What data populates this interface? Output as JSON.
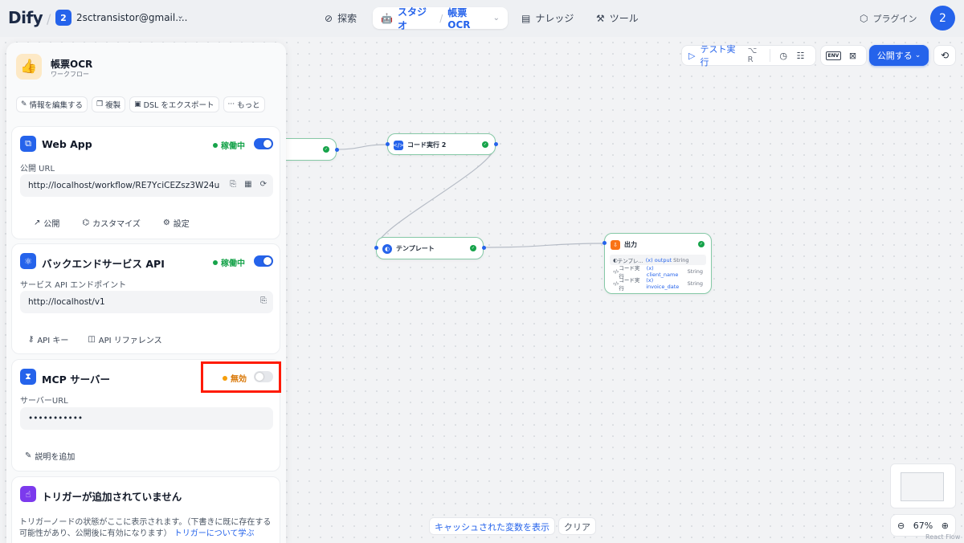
{
  "header": {
    "logo_text": "Dify",
    "workspace_badge": "2",
    "workspace_name": "2sctransistor@gmail....",
    "nav": {
      "explore": "探索",
      "studio": "スタジオ",
      "app_name": "帳票OCR",
      "knowledge": "ナレッジ",
      "tools": "ツール",
      "plugins": "プラグイン"
    },
    "avatar_text": "2"
  },
  "toolbar": {
    "test_run": "テスト実行",
    "test_run_shortcut": "⌥ R",
    "env_label": "ENV",
    "publish": "公開する"
  },
  "nodes": {
    "code2": {
      "title": "コード実行 2"
    },
    "template": {
      "title": "テンプレート"
    },
    "output": {
      "title": "出力",
      "rows": [
        {
          "source": "テンプレ...",
          "var": "output",
          "type": "String"
        },
        {
          "source": "コード実行",
          "var": "client_name",
          "type": "String"
        },
        {
          "source": "コード実行",
          "var": "invoice_date",
          "type": "String"
        }
      ]
    }
  },
  "canvas_footer": {
    "show_cached": "キャッシュされた変数を表示",
    "clear": "クリア",
    "zoom": "67%",
    "attribution": "React Flow"
  },
  "panel": {
    "app_name": "帳票OCR",
    "app_type": "ワークフロー",
    "actions": {
      "edit_info": "情報を編集する",
      "duplicate": "複製",
      "export_dsl": "DSL をエクスポート",
      "more": "もっと"
    },
    "webapp": {
      "title": "Web App",
      "status": "稼働中",
      "url_label": "公開 URL",
      "url": "http://localhost/workflow/RE7YciCEZsz3W24u",
      "link_publish": "公開",
      "link_customize": "カスタマイズ",
      "link_settings": "設定"
    },
    "backend": {
      "title": "バックエンドサービス API",
      "status": "稼働中",
      "endpoint_label": "サービス API エンドポイント",
      "endpoint": "http://localhost/v1",
      "link_api_key": "API キー",
      "link_api_ref": "API リファレンス"
    },
    "mcp": {
      "title": "MCP サーバー",
      "status": "無効",
      "url_label": "サーバーURL",
      "url_masked": "•••••••••••",
      "add_description": "説明を追加"
    },
    "trigger": {
      "title": "トリガーが追加されていません",
      "desc": "トリガーノードの状態がここに表示されます。（下書きに既に存在する可能性があり、公開後に有効になります）",
      "link": "トリガーについて学ぶ"
    }
  },
  "colors": {
    "accent": "#2563eb",
    "active_green": "#16a34a",
    "disabled_orange": "#f59e0b",
    "highlight_red": "#ff1a00"
  }
}
